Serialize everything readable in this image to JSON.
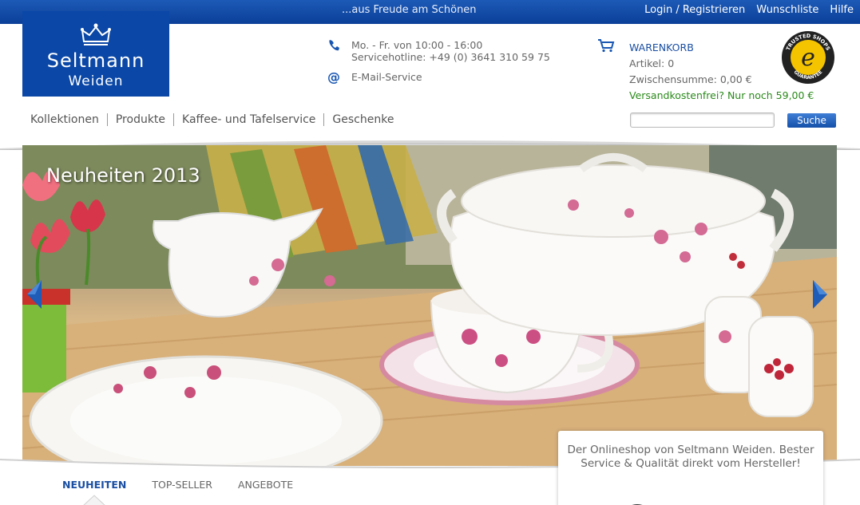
{
  "topbar": {
    "tagline": "...aus Freude am Schönen",
    "links": [
      "Login / Registrieren",
      "Wunschliste",
      "Hilfe"
    ]
  },
  "logo": {
    "brand": "Seltmann",
    "sub": "Weiden"
  },
  "contact": {
    "hours": "Mo. - Fr. von 10:00 - 16:00",
    "hotline": "Servicehotline: +49 (0) 3641 310 59 75",
    "mail": "E-Mail-Service",
    "icons": [
      "phone-icon",
      "at-icon"
    ]
  },
  "cart": {
    "title": "WARENKORB",
    "items": "Artikel: 0",
    "subtotal": "Zwischensumme: 0,00 €",
    "free_shipping": "Versandkostenfrei? Nur noch 59,00 €",
    "icon": "cart-icon"
  },
  "trusted_badge": "TRUSTED SHOPS GUARANTEE",
  "nav": {
    "items": [
      "Kollektionen",
      "Produkte",
      "Kaffee- und Tafelservice",
      "Geschenke"
    ]
  },
  "search": {
    "placeholder": "",
    "button_label": "Suche"
  },
  "hero": {
    "title": "Neuheiten 2013"
  },
  "tabs": {
    "items": [
      "NEUHEITEN",
      "TOP-SELLER",
      "ANGEBOTE"
    ],
    "active": "NEUHEITEN"
  },
  "promo": {
    "text": "Der Onlineshop von Seltmann Weiden. Bester Service & Qualität direkt vom Hersteller!"
  },
  "colors": {
    "brand_blue": "#0a47a6",
    "link_blue": "#1a4fa3",
    "green": "#2a8a1a"
  }
}
